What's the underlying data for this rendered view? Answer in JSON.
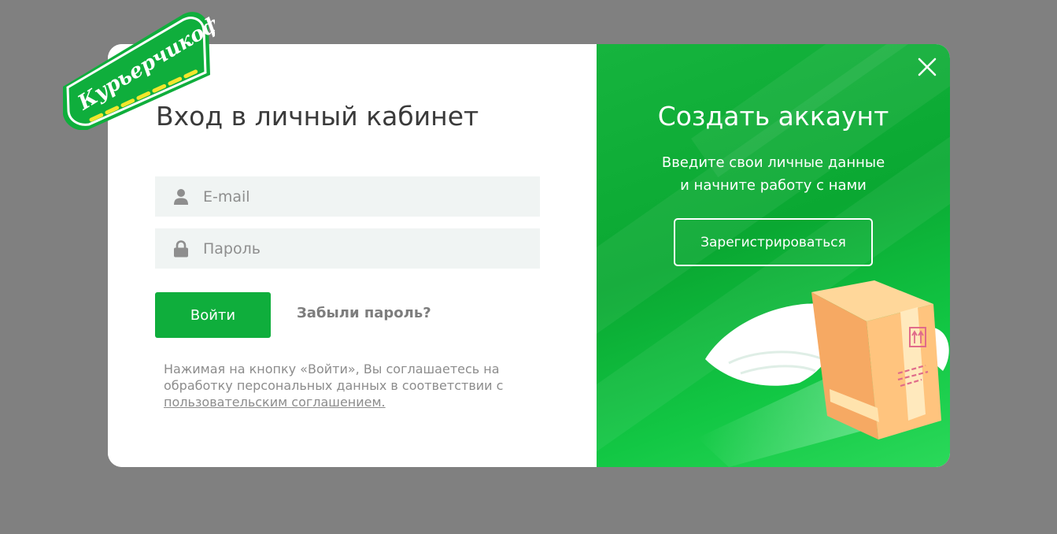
{
  "logo": {
    "text": "Курьерчикоф"
  },
  "login": {
    "title": "Вход в личный кабинет",
    "email_placeholder": "E-mail",
    "password_placeholder": "Пароль",
    "submit_label": "Войти",
    "forgot_label": "Забыли пароль?",
    "agreement_text": "Нажимая на кнопку «Войти», Вы соглашаетесь на обработку персональных данных в соответствии с",
    "agreement_link": "пользовательским соглашением."
  },
  "register": {
    "title": "Создать аккаунт",
    "subtitle_line1": "Введите свои личные данные",
    "subtitle_line2": "и начните работу с нами",
    "button_label": "Зарегистрироваться"
  },
  "icons": {
    "user": "user-icon",
    "lock": "lock-icon",
    "close": "close-icon"
  },
  "colors": {
    "accent": "#0fae3c",
    "overlay": "#808080",
    "field_bg": "#f0f4f3"
  }
}
